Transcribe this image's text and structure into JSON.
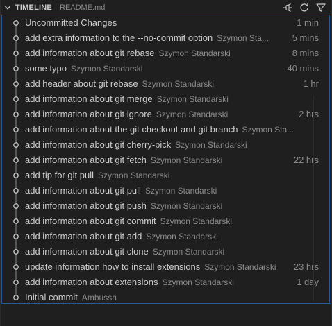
{
  "header": {
    "title": "TIMELINE",
    "file": "README.md",
    "pin_icon": "pin-icon",
    "refresh_icon": "refresh-icon",
    "filter_icon": "filter-icon",
    "collapse_icon": "chevron-down-icon"
  },
  "colors": {
    "panel_bg": "#1f1f1f",
    "focus_border": "#2a5a97",
    "text": "#cccccc",
    "muted": "#8b8b8b"
  },
  "items": [
    {
      "message": "Uncommitted Changes",
      "author": "",
      "time": "1 min"
    },
    {
      "message": "add extra information to the --no-commit option",
      "author": "Szymon Sta...",
      "time": "5 mins"
    },
    {
      "message": "add information about git rebase",
      "author": "Szymon Standarski",
      "time": "8 mins"
    },
    {
      "message": "some typo",
      "author": "Szymon Standarski",
      "time": "40 mins"
    },
    {
      "message": "add header about git rebase",
      "author": "Szymon Standarski",
      "time": "1 hr"
    },
    {
      "message": "add information about git merge",
      "author": "Szymon Standarski",
      "time": ""
    },
    {
      "message": "add information about git ignore",
      "author": "Szymon Standarski",
      "time": "2 hrs"
    },
    {
      "message": "add information about the git checkout and git branch",
      "author": "Szymon Sta...",
      "time": ""
    },
    {
      "message": "add information about git cherry-pick",
      "author": "Szymon Standarski",
      "time": ""
    },
    {
      "message": "add information about git fetch",
      "author": "Szymon Standarski",
      "time": "22 hrs"
    },
    {
      "message": "add tip for git pull",
      "author": "Szymon Standarski",
      "time": ""
    },
    {
      "message": "add information about git pull",
      "author": "Szymon Standarski",
      "time": ""
    },
    {
      "message": "add information about git push",
      "author": "Szymon Standarski",
      "time": ""
    },
    {
      "message": "add information about git commit",
      "author": "Szymon Standarski",
      "time": ""
    },
    {
      "message": "add information about git add",
      "author": "Szymon Standarski",
      "time": ""
    },
    {
      "message": "add information about git clone",
      "author": "Szymon Standarski",
      "time": ""
    },
    {
      "message": "update information how to install extensions",
      "author": "Szymon Standarski",
      "time": "23 hrs"
    },
    {
      "message": "add information about extensions",
      "author": "Szymon Standarski",
      "time": "1 day"
    },
    {
      "message": "Initial commit",
      "author": "Ambussh",
      "time": ""
    }
  ]
}
